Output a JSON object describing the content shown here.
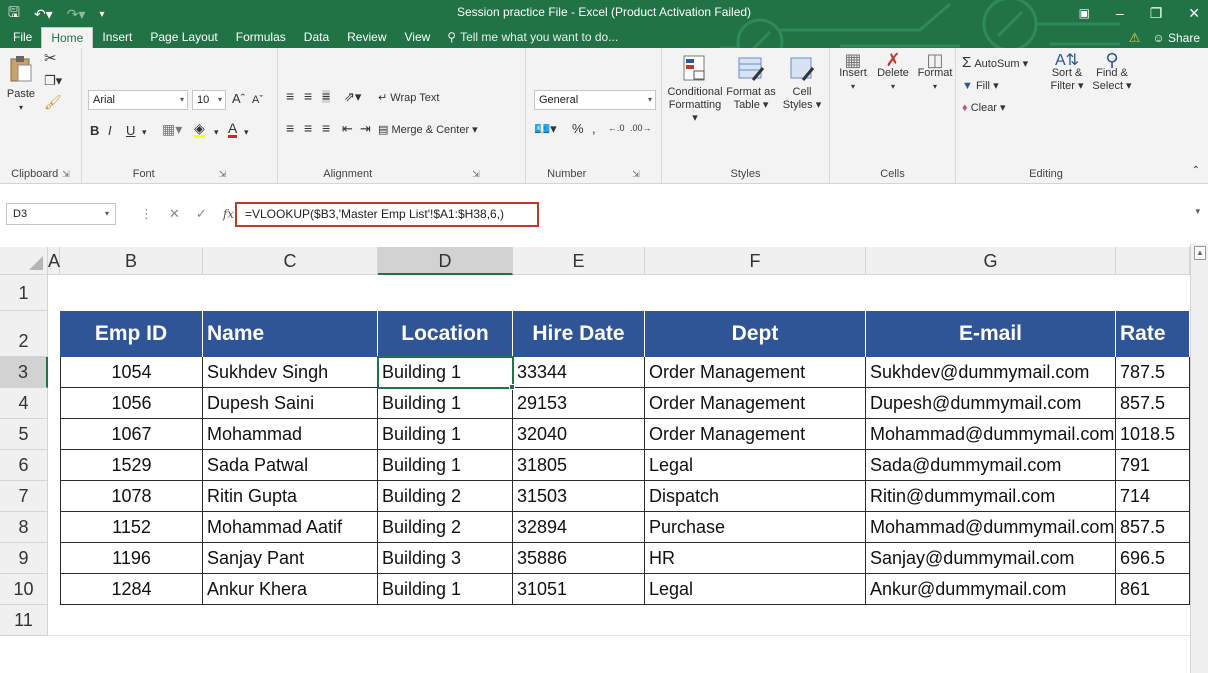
{
  "window": {
    "title": "Session practice File - Excel (Product Activation Failed)",
    "share_label": "Share"
  },
  "tabs": [
    {
      "label": "File"
    },
    {
      "label": "Home"
    },
    {
      "label": "Insert"
    },
    {
      "label": "Page Layout"
    },
    {
      "label": "Formulas"
    },
    {
      "label": "Data"
    },
    {
      "label": "Review"
    },
    {
      "label": "View"
    }
  ],
  "tellme_placeholder": "Tell me what you want to do...",
  "ribbon": {
    "clipboard": {
      "label": "Clipboard",
      "paste": "Paste"
    },
    "font": {
      "label": "Font",
      "name": "Arial",
      "size": "10",
      "bold": "B",
      "italic": "I",
      "underline": "U"
    },
    "alignment": {
      "label": "Alignment",
      "wrap": "Wrap Text",
      "merge": "Merge & Center"
    },
    "number": {
      "label": "Number",
      "format": "General",
      "percent": "%",
      "comma": ","
    },
    "styles": {
      "label": "Styles",
      "cond1": "Conditional",
      "cond2": "Formatting",
      "fmt1": "Format as",
      "fmt2": "Table",
      "cell1": "Cell",
      "cell2": "Styles"
    },
    "cells": {
      "label": "Cells",
      "insert": "Insert",
      "delete": "Delete",
      "format": "Format"
    },
    "editing": {
      "label": "Editing",
      "autosum": "AutoSum",
      "fill": "Fill",
      "clear": "Clear",
      "sort1": "Sort &",
      "sort2": "Filter",
      "find1": "Find &",
      "find2": "Select"
    }
  },
  "formula_bar": {
    "name_box": "D3",
    "formula": "=VLOOKUP($B3,'Master Emp List'!$A1:$H38,6,)"
  },
  "columns": [
    "A",
    "B",
    "C",
    "D",
    "E",
    "F",
    "G"
  ],
  "rows": [
    "1",
    "2",
    "3",
    "4",
    "5",
    "6",
    "7",
    "8",
    "9",
    "10",
    "11"
  ],
  "table": {
    "headers": [
      "Emp ID",
      "Name",
      "Location",
      "Hire Date",
      "Dept",
      "E-mail",
      "Rate"
    ],
    "rows": [
      [
        "1054",
        "Sukhdev Singh",
        "Building 1",
        "33344",
        "Order Management",
        "Sukhdev@dummymail.com",
        "787.5"
      ],
      [
        "1056",
        "Dupesh Saini",
        "Building 1",
        "29153",
        "Order Management",
        "Dupesh@dummymail.com",
        "857.5"
      ],
      [
        "1067",
        "Mohammad",
        "Building 1",
        "32040",
        "Order Management",
        "Mohammad@dummymail.com",
        "1018.5"
      ],
      [
        "1529",
        "Sada Patwal",
        "Building 1",
        "31805",
        "Legal",
        "Sada@dummymail.com",
        "791"
      ],
      [
        "1078",
        "Ritin Gupta",
        "Building 2",
        "31503",
        "Dispatch",
        "Ritin@dummymail.com",
        "714"
      ],
      [
        "1152",
        "Mohammad Aatif",
        "Building 2",
        "32894",
        "Purchase",
        "Mohammad@dummymail.com",
        "857.5"
      ],
      [
        "1196",
        "Sanjay Pant",
        "Building 3",
        "35886",
        "HR",
        "Sanjay@dummymail.com",
        "696.5"
      ],
      [
        "1284",
        "Ankur Khera",
        "Building 1",
        "31051",
        "Legal",
        "Ankur@dummymail.com",
        "861"
      ]
    ]
  },
  "colors": {
    "excel_green": "#217346",
    "header_fill": "#2f5597",
    "formula_highlight": "#c0392b"
  }
}
